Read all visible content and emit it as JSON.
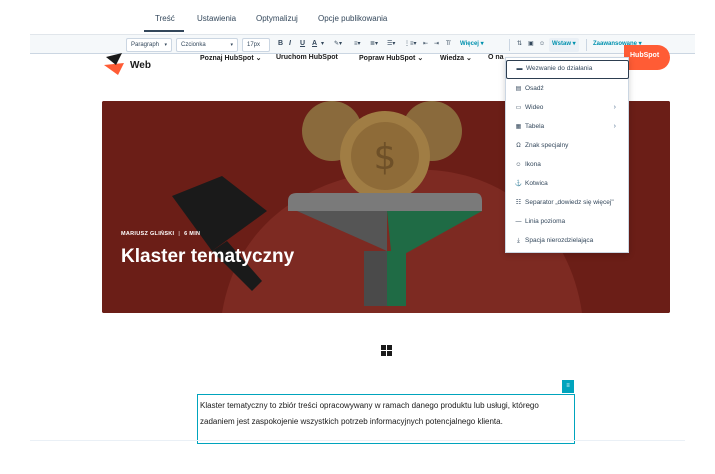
{
  "tabs": [
    {
      "label": "Treść",
      "active": true
    },
    {
      "label": "Ustawienia",
      "active": false
    },
    {
      "label": "Optymalizuj",
      "active": false
    },
    {
      "label": "Opcje publikowania",
      "active": false
    }
  ],
  "toolbar": {
    "paragraph_select": "Paragraph",
    "font_select": "Czcionka",
    "size_select": "17px",
    "bold": "B",
    "italic": "I",
    "underline": "U",
    "text_color": "A",
    "more_label": "Więcej",
    "insert_label": "Wstaw",
    "advanced_label": "Zaawansowane"
  },
  "site_nav": {
    "logo_text": "Web",
    "items": [
      "Poznaj HubSpot",
      "Uruchom HubSpot",
      "Popraw HubSpot",
      "Wiedza",
      "O na"
    ],
    "cta": "HubSpot"
  },
  "hero": {
    "author": "MARIUSZ GLIŃSKI",
    "read_time": "6 MIN",
    "title": "Klaster tematyczny"
  },
  "paragraph": {
    "text": "Klaster tematyczny to zbiór treści opracowywany w ramach danego produktu lub usługi, którego zadaniem jest zaspokojenie wszystkich potrzeb informacyjnych potencjalnego klienta."
  },
  "insert_menu": {
    "items": [
      {
        "label": "Wezwanie do działania",
        "icon": "cta-icon",
        "submenu": false
      },
      {
        "label": "Osadź",
        "icon": "embed-icon",
        "submenu": false
      },
      {
        "label": "Wideo",
        "icon": "video-icon",
        "submenu": true
      },
      {
        "label": "Tabela",
        "icon": "table-icon",
        "submenu": true
      },
      {
        "label": "Znak specjalny",
        "icon": "omega-icon",
        "submenu": false
      },
      {
        "label": "Ikona",
        "icon": "smiley-icon",
        "submenu": false
      },
      {
        "label": "Kotwica",
        "icon": "anchor-icon",
        "submenu": false
      },
      {
        "label": "Separator „dowiedz się więcej\"",
        "icon": "separator-icon",
        "submenu": false
      },
      {
        "label": "Linia pozioma",
        "icon": "horizontal-line-icon",
        "submenu": false
      },
      {
        "label": "Spacja nierozdzielająca",
        "icon": "nbsp-icon",
        "submenu": false
      }
    ]
  },
  "colors": {
    "accent": "#0091ae",
    "brand_orange": "#ff5c35",
    "hero_bg": "#6b1e17",
    "focus": "#00a4bd"
  }
}
